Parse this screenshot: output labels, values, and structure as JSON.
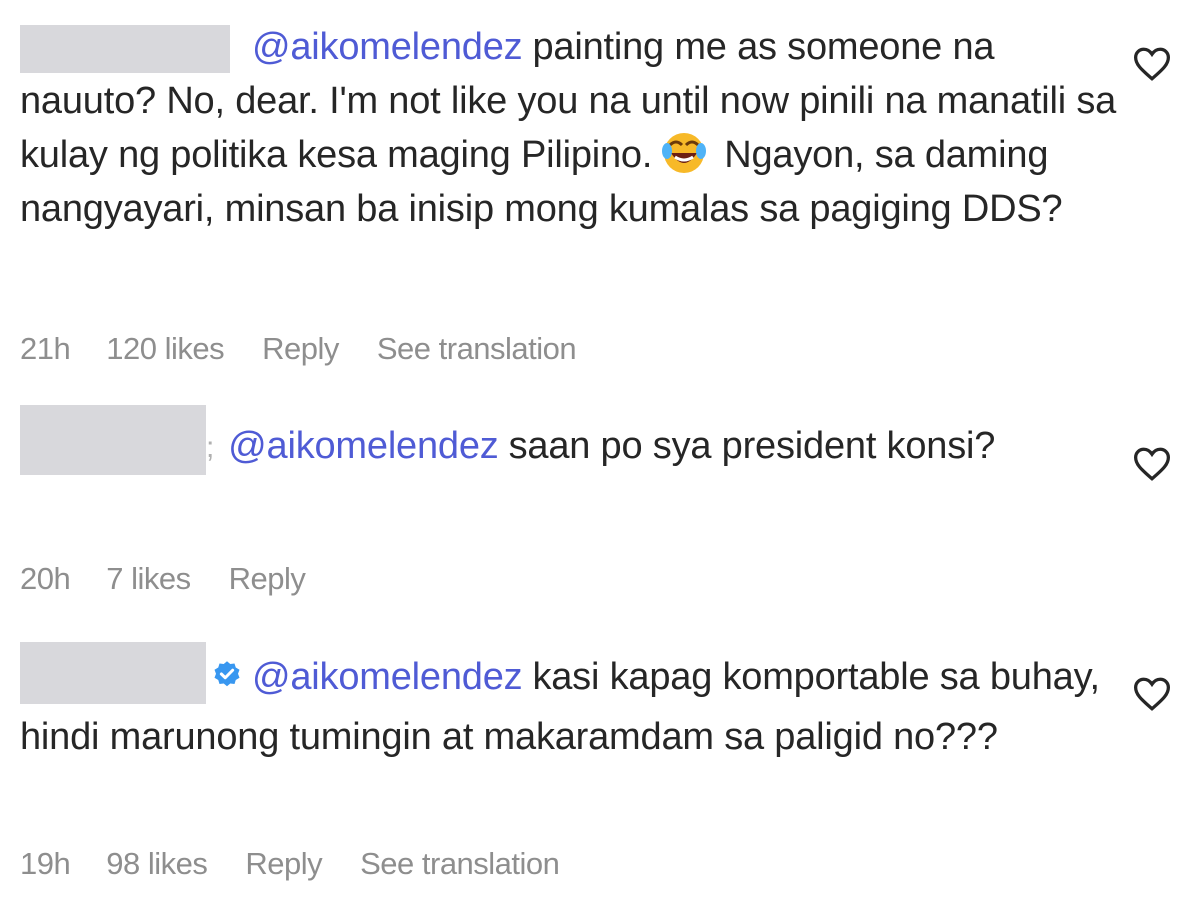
{
  "comments": [
    {
      "mention": "@aikomelendez",
      "text_1": "painting me as someone na nauuto? No, dear. I'm not like you na until now pinili na manatili sa kulay ng politika kesa maging Pilipino.",
      "text_2": "Ngayon, sa daming nangyayari, minsan ba inisip mong kumalas sa pagiging DDS?",
      "emoji": "face-with-tears-of-joy-emoji",
      "time": "21h",
      "likes": "120 likes",
      "reply": "Reply",
      "translation": "See translation"
    },
    {
      "mention": "@aikomelendez",
      "text_1": "saan po sya president konsi?",
      "time": "20h",
      "likes": "7 likes",
      "reply": "Reply"
    },
    {
      "mention": "@aikomelendez",
      "text_1": "kasi kapag komportable sa buhay, hindi marunong tumingin at makaramdam sa paligid no???",
      "verified_icon": "verified-badge-icon",
      "time": "19h",
      "likes": "98 likes",
      "reply": "Reply",
      "translation": "See translation"
    }
  ],
  "icons": {
    "like": "heart-outline-icon"
  },
  "colors": {
    "mention": "#4f5bd5",
    "meta": "#8e8e8e",
    "text": "#262626",
    "verified": "#3897f0",
    "redaction": "#d8d8dc"
  }
}
